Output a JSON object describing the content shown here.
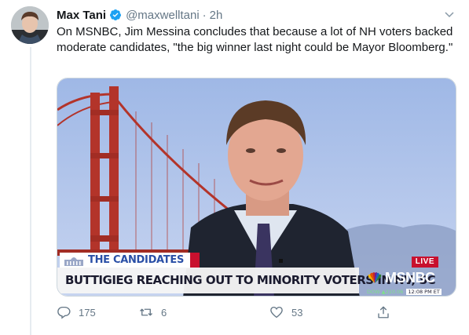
{
  "tweet": {
    "author_name": "Max Tani",
    "handle": "@maxwelltani",
    "separator": "·",
    "time": "2h",
    "text": "On MSNBC, Jim Messina concludes that because a lot of NH voters backed moderate candidates, \"the big winner last night could be Mayor Bloomberg.\"",
    "verified": true
  },
  "media": {
    "tag": "THE CANDIDATES",
    "headline": "BUTTIGIEG REACHING OUT TO MINORITY VOTERS IN NV, SC",
    "live_label": "LIVE",
    "network": "MSNBC",
    "ticker_dow": "DOW ▲210.06",
    "ticker_time": "12:08 PM ET"
  },
  "actions": {
    "reply_count": "175",
    "retweet_count": "6",
    "like_count": "53"
  },
  "colors": {
    "verified_blue": "#1da1f2",
    "muted_gray": "#657786",
    "bridge_red": "#b3342a",
    "live_red": "#c8102e"
  },
  "icons": [
    "verified-badge-icon",
    "chevron-down-icon",
    "reply-icon",
    "retweet-icon",
    "heart-icon",
    "share-icon",
    "peacock-icon"
  ]
}
